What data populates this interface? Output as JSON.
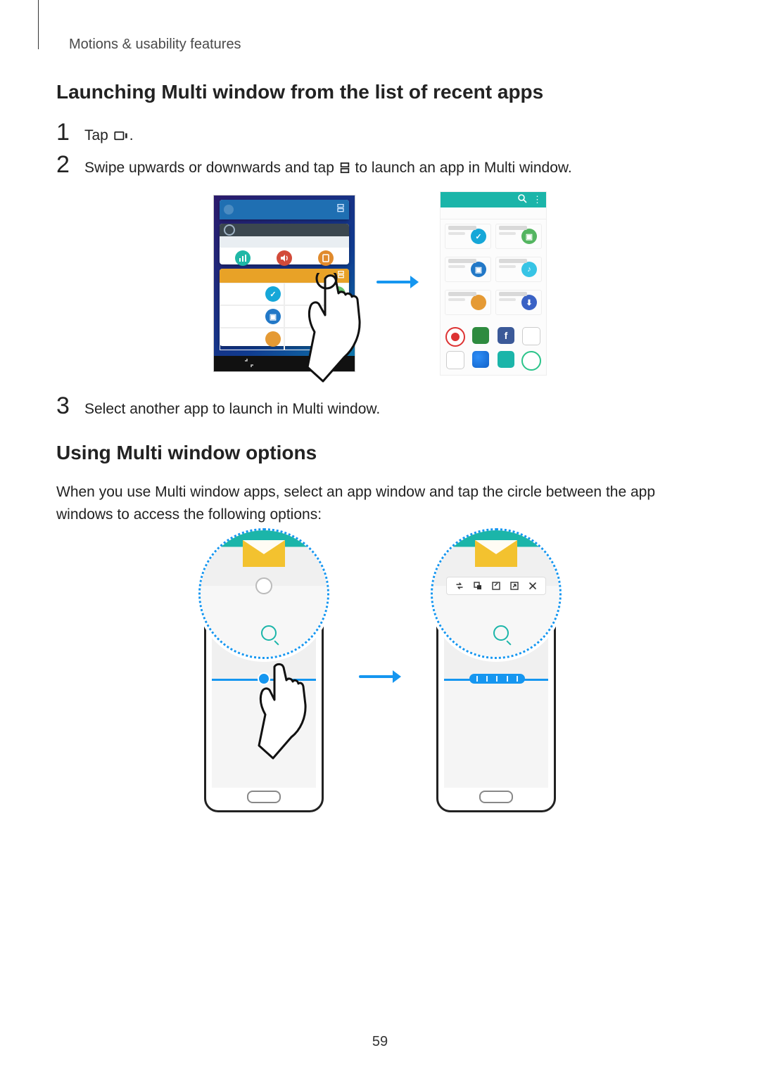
{
  "section_label": "Motions & usability features",
  "heading1": "Launching Multi window from the list of recent apps",
  "steps": {
    "s1_num": "1",
    "s1_text_a": "Tap ",
    "s1_text_b": ".",
    "s2_num": "2",
    "s2_text_a": "Swipe upwards or downwards and tap ",
    "s2_text_b": " to launch an app in Multi window.",
    "s3_num": "3",
    "s3_text": "Select another app to launch in Multi window."
  },
  "heading2": "Using Multi window options",
  "para2": "When you use Multi window apps, select an app window and tap the circle between the app windows to access the following options:",
  "page_number": "59",
  "icons": {
    "recent": "recent-apps-icon",
    "multi": "multi-window-icon",
    "arrow": "right-arrow-icon"
  },
  "zoom_bar_items": [
    "swap",
    "drop",
    "expand-a",
    "expand-b",
    "close"
  ]
}
